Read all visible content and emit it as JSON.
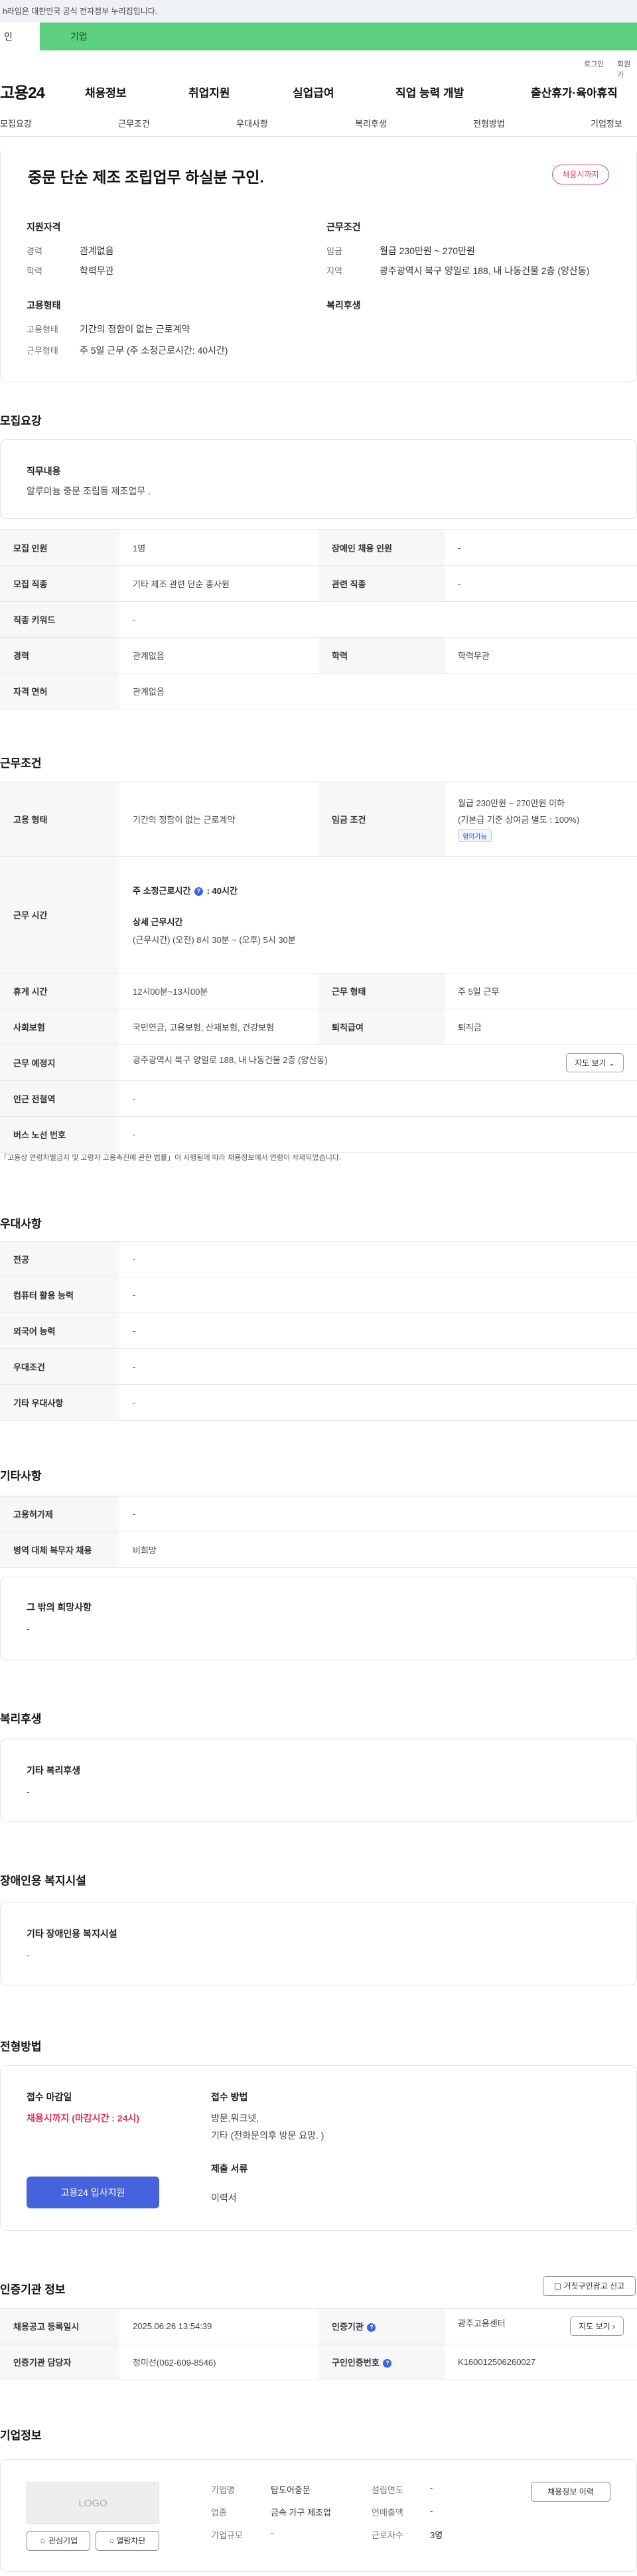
{
  "header": {
    "gov_notice": "h라임은 대한민국 공식 전자정부 누리집입니다.",
    "user_tabs": [
      "인",
      "기업"
    ],
    "util": {
      "login": "로그인",
      "join": "회원가"
    },
    "logo": "고용24",
    "menu": [
      "채용정보",
      "취업지원",
      "실업급여",
      "직업 능력 개발",
      "출산휴가·육아휴직"
    ],
    "tabs": [
      "모집요강",
      "근무조건",
      "우대사항",
      "복리후생",
      "전형방법",
      "기업정보"
    ]
  },
  "summary": {
    "title": "중문 단순 제조 조립업무 하실분 구인.",
    "status_badge": "채용시까지",
    "qual": {
      "heading": "지원자격",
      "rows": [
        {
          "k": "경력",
          "v": "관계없음"
        },
        {
          "k": "학력",
          "v": "학력무관"
        }
      ]
    },
    "cond": {
      "heading": "근무조건",
      "rows": [
        {
          "k": "임금",
          "v": "월급 230만원 ~ 270만원"
        },
        {
          "k": "지역",
          "v": "광주광역시 북구 양일로 188, 내 나동건물 2층 (양산동)"
        }
      ]
    },
    "emp": {
      "heading": "고용형태",
      "rows": [
        {
          "k": "고용형태",
          "v": "기간의 정함이 없는 근로계약"
        },
        {
          "k": "근무형태",
          "v": "주 5일 근무 (주 소정근로시간: 40시간)"
        }
      ]
    },
    "welfare_heading": "복리후생"
  },
  "recruit": {
    "section_title": "모집요강",
    "duty_heading": "직무내용",
    "duty_text": "알루미늄 중문 조립등 제조업무 .",
    "rows": [
      {
        "k": "모집 인원",
        "v": "1명",
        "k2": "장애인 채용 인원",
        "v2": "-"
      },
      {
        "k": "모집 직종",
        "v": "기타 제조 관련 단순 종사원",
        "k2": "관련 직종",
        "v2": "-"
      },
      {
        "k": "직종 키워드",
        "v": "-"
      },
      {
        "k": "경력",
        "v": "관계없음",
        "k2": "학력",
        "v2": "학력무관"
      },
      {
        "k": "자격 면허",
        "v": "관계없음"
      }
    ]
  },
  "work": {
    "section_title": "근무조건",
    "emp_type_k": "고용 형태",
    "emp_type_v": "기간의 정함이 없는 근로계약",
    "wage_k": "임금 조건",
    "wage_line1": "월급 230만원 ~ 270만원 이하",
    "wage_line2": "(기본급 기준 상여금 별도 : 100%)",
    "wage_tag": "협의가능",
    "hours_k": "근무 시간",
    "hours_week_label": "주 소정근로시간",
    "hours_week_value": ": 40시간",
    "hours_detail_label": "상세 근무시간",
    "hours_detail_value": "(근무시간) (오전) 8시 30분 ~ (오후) 5시 30분",
    "rest_k": "휴게 시간",
    "rest_v": "12시00분~13시00분",
    "shift_k": "근무 형태",
    "shift_v": "주 5일 근무",
    "insurance_k": "사회보험",
    "insurance_v": "국민연금, 고용보험, 산재보험, 건강보험",
    "severance_k": "퇴직급여",
    "severance_v": "퇴직금",
    "place_k": "근무 예정지",
    "place_v": "광주광역시 북구 양일로 188, 내 나동건물 2층 (양산동)",
    "map_btn": "지도 보기",
    "subway_k": "인근 전철역",
    "subway_v": "-",
    "bus_k": "버스 노선 번호",
    "bus_v": "-",
    "note": "「고용상 연령차별금지 및 고령자 고용촉진에 관한 법률」이 시행됨에 따라 채용정보에서 연령이 삭제되었습니다."
  },
  "pref": {
    "section_title": "우대사항",
    "rows": [
      {
        "k": "전공",
        "v": "-"
      },
      {
        "k": "컴퓨터 활용 능력",
        "v": "-"
      },
      {
        "k": "외국어 능력",
        "v": "-"
      },
      {
        "k": "우대조건",
        "v": "-"
      },
      {
        "k": "기타 우대사항",
        "v": "-"
      }
    ]
  },
  "etc": {
    "section_title": "기타사항",
    "rows": [
      {
        "k": "고용허가제",
        "v": "-"
      },
      {
        "k": "병역 대체 복무자 채용",
        "v": "비희망"
      }
    ],
    "wish_heading": "그 밖의 희망사항",
    "wish_value": "-"
  },
  "welfare": {
    "section_title": "복리후생",
    "heading": "기타 복리후생",
    "value": "-"
  },
  "facility": {
    "section_title": "장애인용 복지시설",
    "heading": "기타 장애인용 복지시설",
    "value": "-"
  },
  "process": {
    "section_title": "전형방법",
    "deadline_heading": "접수 마감일",
    "deadline_value": "채용시까지 (마감시간 : 24시)",
    "apply_btn": "고용24 입사지원",
    "method_heading": "접수 방법",
    "method_line1": "방문,워크넷,",
    "method_line2": "기타 (전화문의후 방문 요망. )",
    "docs_heading": "제출 서류",
    "docs_value": "이력서"
  },
  "cert": {
    "section_title": "인증기관 정보",
    "report_btn": "거짓구인광고 신고",
    "reg_k": "채용공고 등록일시",
    "reg_v": "2025.06.26 13:54:39",
    "agency_k": "인증기관",
    "agency_v": "광주고용센터",
    "map_btn": "지도 보기",
    "manager_k": "인증기관 담당자",
    "manager_v": "정미선(062-609-8546)",
    "reqno_k": "구인인증번호",
    "reqno_v": "K160012506260027"
  },
  "company": {
    "section_title": "기업정보",
    "logo_text": "LOGO",
    "fav_btn": "관심기업",
    "block_btn": "열람차단",
    "history_btn": "채용정보 이력",
    "name_k": "기업명",
    "name_v": "탑도어중문",
    "industry_k": "업종",
    "industry_v": "금속 가구 제조업",
    "size_k": "기업규모",
    "size_v": "-",
    "founded_k": "설립연도",
    "founded_v": "-",
    "sales_k": "연매출액",
    "sales_v": "-",
    "employees_k": "근로자수",
    "employees_v": "3명"
  }
}
